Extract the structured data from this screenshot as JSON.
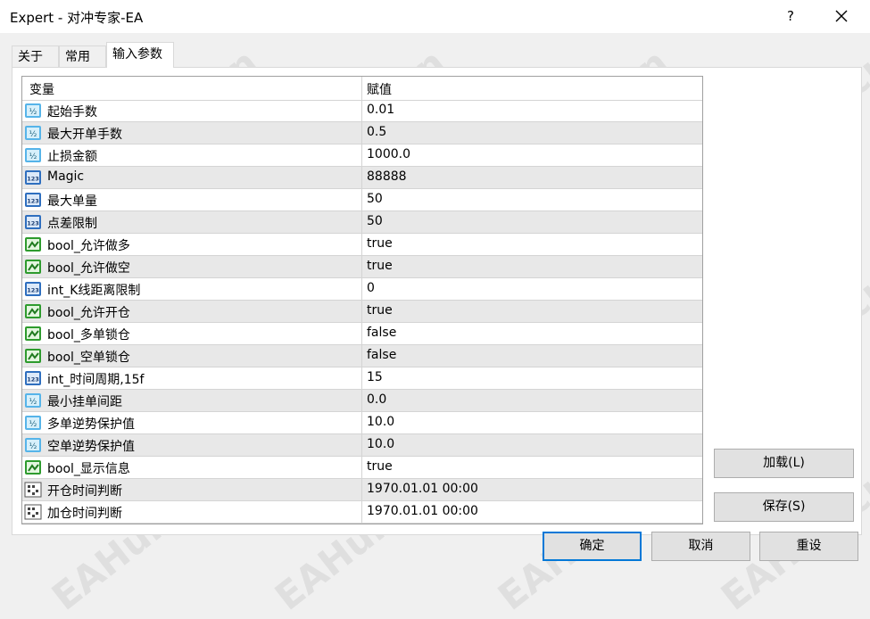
{
  "window": {
    "title": "Expert - 对冲专家-EA",
    "help_label": "?"
  },
  "tabs": [
    {
      "label": "关于"
    },
    {
      "label": "常用"
    },
    {
      "label": "输入参数",
      "active": true
    }
  ],
  "grid": {
    "col_variable": "变量",
    "col_value": "赋值",
    "rows": [
      {
        "name": "起始手数",
        "value": "0.01",
        "type": "double"
      },
      {
        "name": "最大开单手数",
        "value": "0.5",
        "type": "double"
      },
      {
        "name": "止损金额",
        "value": "1000.0",
        "type": "double"
      },
      {
        "name": "Magic",
        "value": "88888",
        "type": "int"
      },
      {
        "name": "最大单量",
        "value": "50",
        "type": "int"
      },
      {
        "name": "点差限制",
        "value": "50",
        "type": "int"
      },
      {
        "name": "bool_允许做多",
        "value": "true",
        "type": "bool"
      },
      {
        "name": "bool_允许做空",
        "value": "true",
        "type": "bool"
      },
      {
        "name": "int_K线距离限制",
        "value": "0",
        "type": "int"
      },
      {
        "name": "bool_允许开仓",
        "value": "true",
        "type": "bool"
      },
      {
        "name": "bool_多单锁仓",
        "value": "false",
        "type": "bool"
      },
      {
        "name": "bool_空单锁仓",
        "value": "false",
        "type": "bool"
      },
      {
        "name": "int_时间周期,15f",
        "value": "15",
        "type": "int"
      },
      {
        "name": "最小挂单间距",
        "value": "0.0",
        "type": "double"
      },
      {
        "name": "多单逆势保护值",
        "value": "10.0",
        "type": "double"
      },
      {
        "name": "空单逆势保护值",
        "value": "10.0",
        "type": "double"
      },
      {
        "name": "bool_显示信息",
        "value": "true",
        "type": "bool"
      },
      {
        "name": "开仓时间判断",
        "value": "1970.01.01 00:00",
        "type": "datetime"
      },
      {
        "name": "加仓时间判断",
        "value": "1970.01.01 00:00",
        "type": "datetime"
      }
    ]
  },
  "buttons": {
    "load": "加载(L)",
    "save": "保存(S)",
    "ok": "确定",
    "cancel": "取消",
    "reset": "重设"
  },
  "watermark": "EAHub.cn",
  "colors": {
    "default_button_border": "#0078d7",
    "alt_row": "#e8e8e8",
    "icon_double": "#56b4e9",
    "icon_int": "#2f6fbf",
    "icon_bool": "#2e9b2e"
  }
}
